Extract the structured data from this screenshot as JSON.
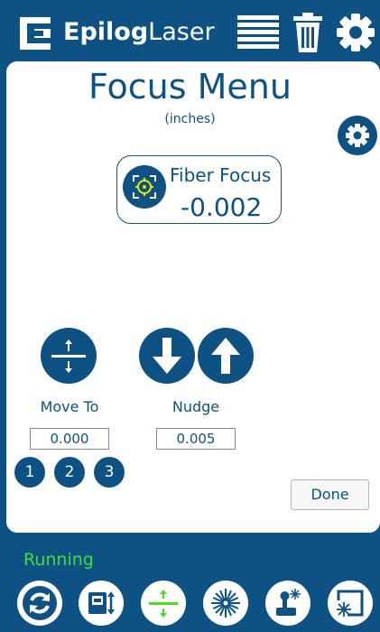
{
  "header": {
    "logo_bold": "Epilog",
    "logo_light": "Laser"
  },
  "page": {
    "title": "Focus Menu",
    "units": "(inches)"
  },
  "fiber_focus": {
    "label": "Fiber Focus",
    "value": "-0.002"
  },
  "move_to": {
    "label": "Move To",
    "value": "0.000",
    "presets": [
      "1",
      "2",
      "3"
    ]
  },
  "nudge": {
    "label": "Nudge",
    "value": "0.005"
  },
  "done_label": "Done",
  "status": {
    "text": "Running",
    "color": "#3ce03c"
  },
  "colors": {
    "brand": "#0e5183",
    "accent_yellow": "#e8e800"
  },
  "toolbar": {
    "icons": [
      "refresh-icon",
      "job-list-icon",
      "focus-icon",
      "laser-icon",
      "joystick-icon",
      "laser-frame-icon"
    ]
  }
}
